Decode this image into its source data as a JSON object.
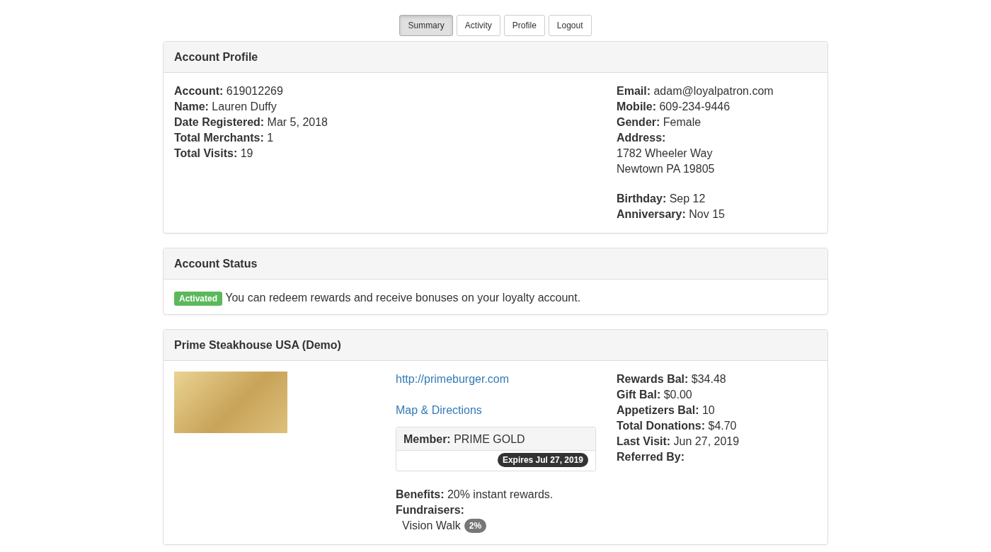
{
  "nav": [
    {
      "label": "Summary",
      "selected": true
    },
    {
      "label": "Activity",
      "selected": false
    },
    {
      "label": "Profile",
      "selected": false
    },
    {
      "label": "Logout",
      "selected": false
    }
  ],
  "account_profile": {
    "title": "Account Profile",
    "left": [
      {
        "label": "Account:",
        "value": "619012269"
      },
      {
        "label": "Name:",
        "value": "Lauren Duffy"
      },
      {
        "label": "Date Registered:",
        "value": "Mar 5, 2018"
      },
      {
        "label": "Total Merchants:",
        "value": "1"
      },
      {
        "label": "Total Visits:",
        "value": "19"
      }
    ],
    "right": [
      {
        "label": "Email:",
        "value": "adam@loyalpatron.com"
      },
      {
        "label": "Mobile:",
        "value": "609-234-9446"
      },
      {
        "label": "Gender:",
        "value": "Female"
      },
      {
        "label": "Address:"
      }
    ],
    "address_lines": [
      "1782 Wheeler Way",
      "Newtown PA 19805"
    ],
    "dates": [
      {
        "label": "Birthday:",
        "value": "Sep 12"
      },
      {
        "label": "Anniversary:",
        "value": "Nov 15"
      }
    ]
  },
  "account_status": {
    "title": "Account Status",
    "badge": "Activated",
    "message": "You can redeem rewards and receive bonuses on your loyalty account."
  },
  "merchant": {
    "title": "Prime Steakhouse USA (Demo)",
    "links": [
      "http://primeburger.com",
      "Map & Directions"
    ],
    "membership": {
      "label": "Member:",
      "value": "PRIME GOLD",
      "expires": "Expires Jul 27, 2019"
    },
    "benefits": {
      "label": "Benefits:",
      "value": "20% instant rewards."
    },
    "fundraisers_label": "Fundraisers:",
    "fundraisers": [
      {
        "name": "Vision Walk",
        "percent": "2%"
      }
    ],
    "balances": [
      {
        "label": "Rewards Bal:",
        "value": "$34.48"
      },
      {
        "label": "Gift Bal:",
        "value": "$0.00"
      },
      {
        "label": "Appetizers Bal:",
        "value": "10"
      },
      {
        "label": "Total Donations:",
        "value": "$4.70"
      },
      {
        "label": "Last Visit:",
        "value": "Jun 27, 2019"
      },
      {
        "label": "Referred By:"
      }
    ]
  }
}
